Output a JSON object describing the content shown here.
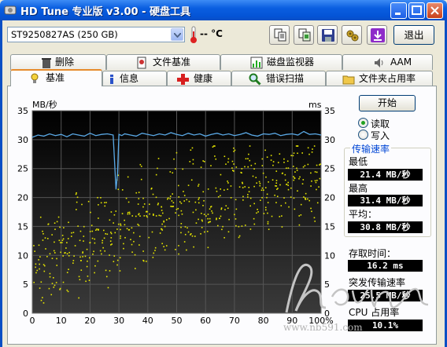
{
  "window": {
    "title": "HD Tune 专业版 v3.00 - 硬盘工具",
    "titlebar_color": "#0a5ee0"
  },
  "toolbar": {
    "drive": "ST9250827AS (250 GB)",
    "temperature": "-- °C",
    "exit_label": "退出",
    "icons": [
      "copy-text-icon",
      "copy-screenshot-icon",
      "save-icon",
      "options-icon",
      "download-icon"
    ]
  },
  "tabs": {
    "row1": [
      "删除",
      "文件基准",
      "磁盘监视器",
      "AAM"
    ],
    "row2": [
      "基准",
      "信息",
      "健康",
      "错误扫描",
      "文件夹占用率"
    ],
    "active": "基准"
  },
  "chart_data": {
    "type": "line+scatter",
    "y_left_label": "MB/秒",
    "y_right_label": "ms",
    "y_ticks": [
      0,
      5,
      10,
      15,
      20,
      25,
      30,
      35
    ],
    "y_right_ticks": [
      0,
      5,
      10,
      15,
      20,
      25,
      30,
      35
    ],
    "x_ticks": [
      "0",
      "10",
      "20",
      "30",
      "40",
      "50",
      "60",
      "70",
      "80",
      "90",
      "100%"
    ],
    "ylim": [
      0,
      35
    ],
    "xlim": [
      0,
      100
    ],
    "grid": true,
    "background": "#000000",
    "line_color": "#5aa9e6",
    "scatter_color": "#e6e600",
    "series": [
      {
        "kind": "transfer_rate",
        "unit": "MB/s",
        "x": [
          0,
          2,
          4,
          6,
          8,
          10,
          12,
          14,
          16,
          18,
          20,
          22,
          24,
          26,
          28,
          29,
          29.5,
          30,
          31,
          32,
          34,
          36,
          38,
          40,
          42,
          44,
          46,
          48,
          50,
          52,
          54,
          56,
          58,
          60,
          62,
          64,
          66,
          68,
          70,
          72,
          74,
          76,
          78,
          80,
          82,
          84,
          86,
          88,
          90,
          92,
          94,
          96,
          98,
          100
        ],
        "values": [
          30.4,
          30.8,
          30.6,
          31.0,
          30.7,
          30.9,
          30.5,
          31.0,
          30.8,
          30.6,
          31.1,
          30.7,
          30.9,
          31.0,
          30.8,
          21.4,
          24.0,
          30.9,
          30.7,
          31.0,
          30.8,
          30.6,
          31.1,
          30.9,
          30.7,
          31.0,
          30.8,
          31.2,
          30.9,
          30.7,
          31.1,
          30.8,
          31.0,
          30.6,
          30.9,
          31.1,
          30.8,
          31.0,
          30.7,
          30.9,
          31.2,
          30.8,
          30.6,
          31.0,
          30.9,
          31.1,
          30.7,
          30.9,
          31.0,
          30.8,
          31.4,
          30.9,
          31.0,
          30.8
        ]
      },
      {
        "kind": "access_time",
        "unit": "ms",
        "x": [
          1,
          2,
          3,
          4,
          5,
          6,
          7,
          8,
          9,
          10,
          11,
          12,
          13,
          14,
          15,
          16,
          17,
          18,
          19,
          20,
          21,
          22,
          23,
          24,
          25,
          26,
          27,
          28,
          29,
          30,
          31,
          32,
          33,
          34,
          35,
          36,
          37,
          38,
          39,
          40,
          41,
          42,
          43,
          44,
          45,
          46,
          47,
          48,
          49,
          50,
          51,
          52,
          53,
          54,
          55,
          56,
          57,
          58,
          59,
          60,
          61,
          62,
          63,
          64,
          65,
          66,
          67,
          68,
          69,
          70,
          71,
          72,
          73,
          74,
          75,
          76,
          77,
          78,
          79,
          80,
          81,
          82,
          83,
          84,
          85,
          86,
          87,
          88,
          89,
          90,
          91,
          92,
          93,
          94,
          95,
          96,
          97,
          98,
          99
        ],
        "values": [
          8,
          12,
          5,
          10,
          14,
          7,
          11,
          6,
          13,
          9,
          15,
          8,
          12,
          10,
          16,
          7,
          14,
          11,
          9,
          17,
          13,
          10,
          18,
          12,
          15,
          9,
          16,
          14,
          19,
          11,
          17,
          13,
          20,
          15,
          12,
          18,
          16,
          21,
          14,
          17,
          19,
          13,
          22,
          16,
          18,
          15,
          20,
          17,
          23,
          14,
          19,
          21,
          16,
          18,
          24,
          15,
          20,
          17,
          22,
          19,
          16,
          21,
          25,
          18,
          20,
          17,
          23,
          19,
          22,
          24,
          18,
          21,
          20,
          23,
          26,
          19,
          22,
          20,
          24,
          21,
          25,
          19,
          23,
          22,
          26,
          20,
          24,
          21,
          25,
          23,
          22,
          27,
          20,
          24,
          23,
          26,
          21,
          25,
          24
        ]
      }
    ]
  },
  "controls": {
    "start_label": "开始",
    "read_label": "读取",
    "write_label": "写入",
    "selected": "读取"
  },
  "stats": {
    "group_title": "传输速率",
    "min_label": "最低",
    "min_value": "21.4 MB/秒",
    "max_label": "最高",
    "max_value": "31.4 MB/秒",
    "avg_label": "平均：",
    "avg_value": "30.8 MB/秒",
    "access_label": "存取时间：",
    "access_value": "16.2 ms",
    "burst_label": "突发传输速率",
    "burst_value": "25.5 MB/秒",
    "cpu_label": "CPU 占用率",
    "cpu_value": "10.1%"
  },
  "watermark": {
    "text": "www.nb591.com"
  }
}
